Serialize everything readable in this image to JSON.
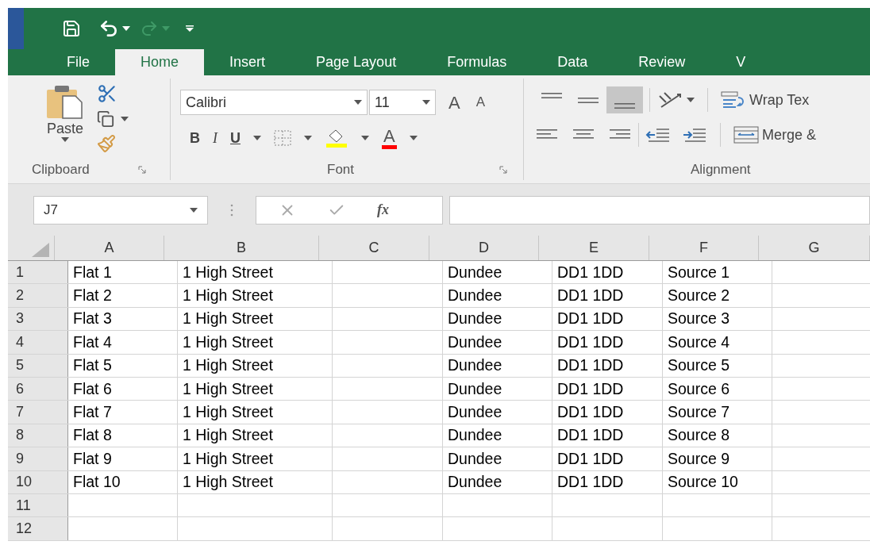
{
  "tabs": [
    {
      "label": "File",
      "selected": false
    },
    {
      "label": "Home",
      "selected": true
    },
    {
      "label": "Insert",
      "selected": false
    },
    {
      "label": "Page Layout",
      "selected": false
    },
    {
      "label": "Formulas",
      "selected": false
    },
    {
      "label": "Data",
      "selected": false
    },
    {
      "label": "Review",
      "selected": false
    },
    {
      "label": "V",
      "selected": false
    }
  ],
  "ribbon": {
    "clipboard": {
      "label": "Clipboard",
      "paste": "Paste"
    },
    "font": {
      "label": "Font",
      "font_name": "Calibri",
      "font_size": "11",
      "grow": "A",
      "shrink": "A",
      "bold": "B",
      "italic": "I",
      "underline": "U",
      "font_color": "A"
    },
    "alignment": {
      "label": "Alignment",
      "wrap_text": "Wrap Tex",
      "merge": "Merge &",
      "vertical": [
        {
          "kind": "top",
          "selected": false
        },
        {
          "kind": "middle",
          "selected": false
        },
        {
          "kind": "bottom",
          "selected": true
        }
      ]
    }
  },
  "formula_bar": {
    "name_box": "J7",
    "fx": "fx"
  },
  "sheet": {
    "columns": [
      "A",
      "B",
      "C",
      "D",
      "E",
      "F",
      "G"
    ],
    "rows": [
      {
        "number": "1",
        "a": "Flat 1",
        "b": "1 High Street",
        "d": "Dundee",
        "e": "DD1 1DD",
        "f": "Source 1"
      },
      {
        "number": "2",
        "a": "Flat 2",
        "b": "1 High Street",
        "d": "Dundee",
        "e": "DD1 1DD",
        "f": "Source 2"
      },
      {
        "number": "3",
        "a": "Flat 3",
        "b": "1 High Street",
        "d": "Dundee",
        "e": "DD1 1DD",
        "f": "Source 3"
      },
      {
        "number": "4",
        "a": "Flat 4",
        "b": "1 High Street",
        "d": "Dundee",
        "e": "DD1 1DD",
        "f": "Source 4"
      },
      {
        "number": "5",
        "a": "Flat 5",
        "b": "1 High Street",
        "d": "Dundee",
        "e": "DD1 1DD",
        "f": "Source 5"
      },
      {
        "number": "6",
        "a": "Flat 6",
        "b": "1 High Street",
        "d": "Dundee",
        "e": "DD1 1DD",
        "f": "Source 6"
      },
      {
        "number": "7",
        "a": "Flat 7",
        "b": "1 High Street",
        "d": "Dundee",
        "e": "DD1 1DD",
        "f": "Source 7"
      },
      {
        "number": "8",
        "a": "Flat 8",
        "b": "1 High Street",
        "d": "Dundee",
        "e": "DD1 1DD",
        "f": "Source 8"
      },
      {
        "number": "9",
        "a": "Flat 9",
        "b": "1 High Street",
        "d": "Dundee",
        "e": "DD1 1DD",
        "f": "Source 9"
      },
      {
        "number": "10",
        "a": "Flat 10",
        "b": "1 High Street",
        "d": "Dundee",
        "e": "DD1 1DD",
        "f": "Source 10"
      },
      {
        "number": "11"
      },
      {
        "number": "12"
      }
    ]
  }
}
